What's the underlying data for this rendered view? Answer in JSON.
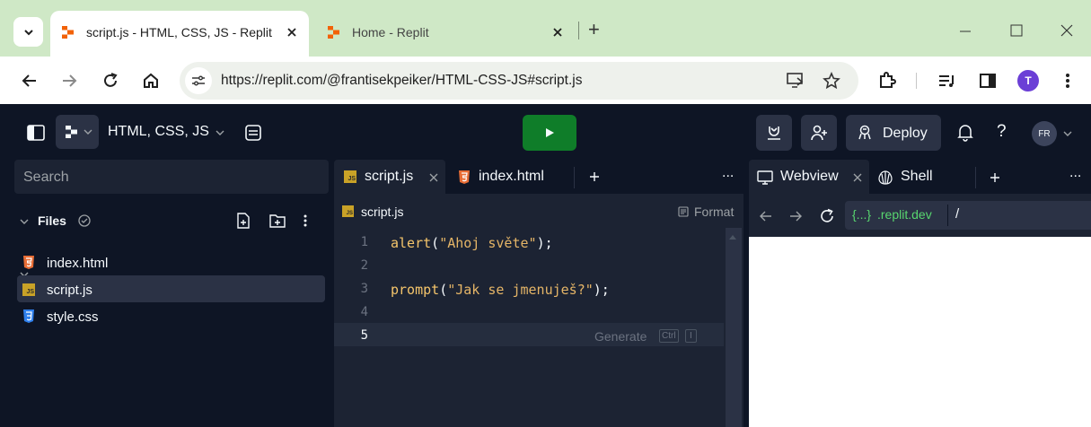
{
  "browser": {
    "tabs": [
      {
        "title": "script.js - HTML, CSS, JS - Replit",
        "active": true
      },
      {
        "title": "Home - Replit",
        "active": false
      }
    ],
    "new_tab": "+",
    "url": "https://replit.com/@frantisekpeiker/HTML-CSS-JS#script.js",
    "profile_initial": "T"
  },
  "replit": {
    "repl_name": "HTML, CSS, JS",
    "deploy_label": "Deploy",
    "help": "?",
    "avatar_initials": "FR",
    "sidebar": {
      "search_placeholder": "Search",
      "files_label": "Files",
      "files": [
        {
          "name": "index.html",
          "type": "html"
        },
        {
          "name": "script.js",
          "type": "js",
          "selected": true
        },
        {
          "name": "style.css",
          "type": "css"
        }
      ]
    },
    "editor": {
      "tabs": [
        {
          "label": "script.js",
          "active": true
        },
        {
          "label": "index.html",
          "active": false
        }
      ],
      "breadcrumb": "script.js",
      "format_label": "Format",
      "more": "...",
      "lines": [
        {
          "num": "1",
          "fn": "alert",
          "open": "(",
          "str": "\"Ahoj světe\"",
          "close": ");"
        },
        {
          "num": "2"
        },
        {
          "num": "3",
          "fn": "prompt",
          "open": "(",
          "str": "\"Jak se jmenuješ?\"",
          "close": ");"
        },
        {
          "num": "4"
        },
        {
          "num": "5"
        }
      ],
      "generate_hint": "Generate",
      "generate_keys": [
        "Ctrl",
        "I"
      ]
    },
    "webview": {
      "tabs": [
        {
          "label": "Webview",
          "active": true
        },
        {
          "label": "Shell",
          "active": false
        }
      ],
      "url_badge": "{...}",
      "url_domain": ".replit.dev",
      "url_path": "/",
      "more": "..."
    },
    "colors": {
      "run_button": "#0f7d29",
      "string": "#e5b567",
      "function": "#f4a261"
    }
  }
}
